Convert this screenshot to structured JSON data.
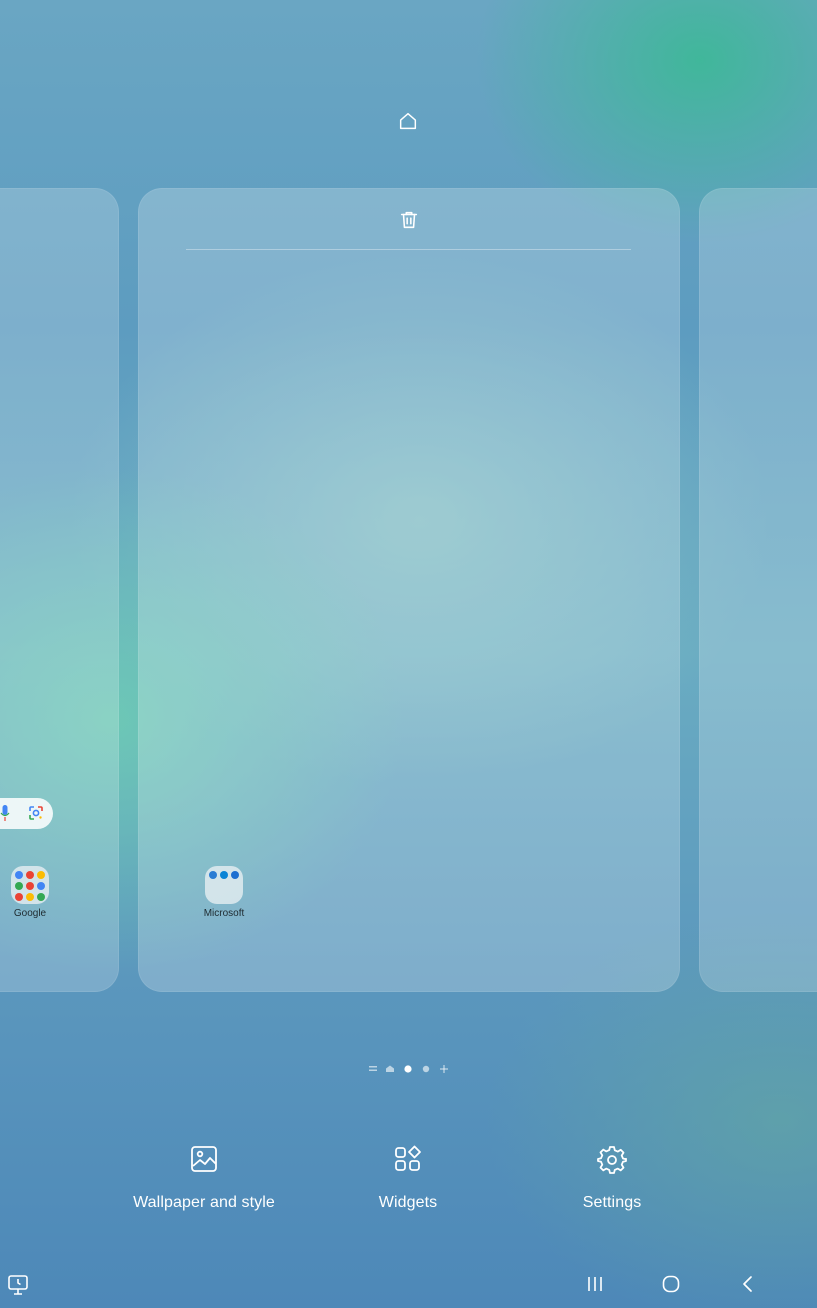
{
  "edit_mode": {
    "home_page_icon": "house-outline-icon",
    "remove_page_icon": "trash-icon",
    "page_indicator": {
      "current_index": 2,
      "total_pages": 3
    }
  },
  "left_page": {
    "search_bar": {
      "mic_icon": "microphone-icon",
      "lens_icon": "google-lens-icon"
    },
    "folder": {
      "label": "Google"
    }
  },
  "center_page": {
    "folder": {
      "label": "Microsoft"
    }
  },
  "actions": {
    "wallpaper_label": "Wallpaper and style",
    "widgets_label": "Widgets",
    "settings_label": "Settings"
  },
  "nav_bar": {
    "screen_icon": "display-icon",
    "recents_icon": "recents-icon",
    "home_icon": "home-circle-icon",
    "back_icon": "back-chevron-icon"
  },
  "colors": {
    "icon_white": "#ffffff",
    "folder_bg": "#e1ebf0",
    "label_dark": "#1e2a30"
  }
}
